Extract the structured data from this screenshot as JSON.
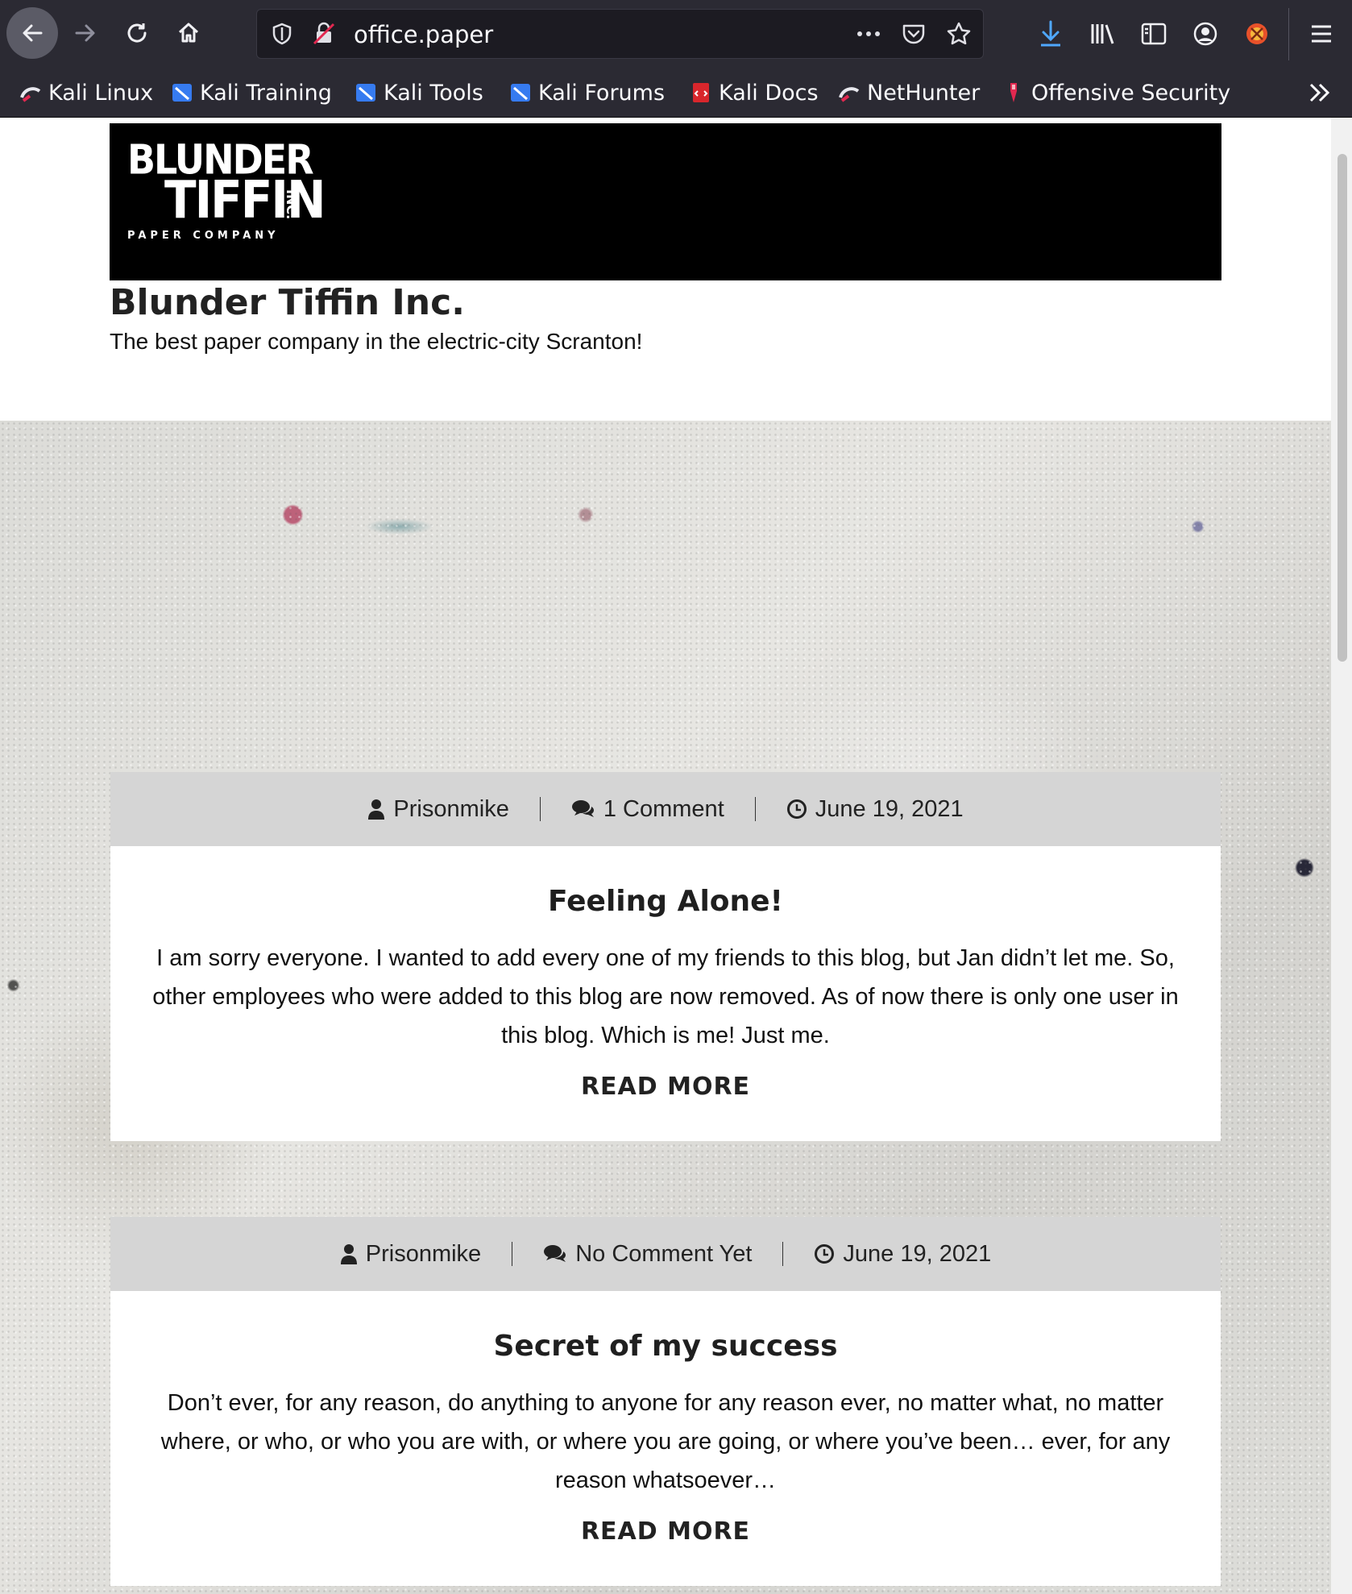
{
  "browser": {
    "url": "office.paper",
    "bookmarks": [
      {
        "label": "Kali Linux",
        "icon": "kali-dragon-icon"
      },
      {
        "label": "Kali Training",
        "icon": "kali-training-icon"
      },
      {
        "label": "Kali Tools",
        "icon": "kali-tools-icon"
      },
      {
        "label": "Kali Forums",
        "icon": "kali-forums-icon"
      },
      {
        "label": "Kali Docs",
        "icon": "kali-docs-icon"
      },
      {
        "label": "NetHunter",
        "icon": "nethunter-icon"
      },
      {
        "label": "Offensive Security",
        "icon": "offsec-icon"
      }
    ]
  },
  "site": {
    "logo": {
      "line1": "BLUNDER",
      "line2": "TIFFIN",
      "inc": "INC.",
      "line3": "PAPER COMPANY"
    },
    "title": "Blunder Tiffin Inc.",
    "tagline": "The best paper company in the electric-city Scranton!"
  },
  "posts": [
    {
      "author": "Prisonmike",
      "comments": "1 Comment",
      "date": "June 19, 2021",
      "title": "Feeling Alone!",
      "excerpt": "I am sorry everyone. I wanted to add every one of my friends to this blog, but Jan didn’t let me. So, other employees who were added to this blog are now removed. As of now there is only one user in this blog. Which is me! Just me.",
      "read_more": "READ MORE"
    },
    {
      "author": "Prisonmike",
      "comments": "No Comment Yet",
      "date": "June 19, 2021",
      "title": "Secret of my success",
      "excerpt": "Don’t ever, for any reason, do anything to anyone for any reason ever, no matter what, no matter where, or who, or who you are with, or where you are going, or where you’ve been… ever, for any reason whatsoever…",
      "read_more": "READ MORE"
    }
  ]
}
